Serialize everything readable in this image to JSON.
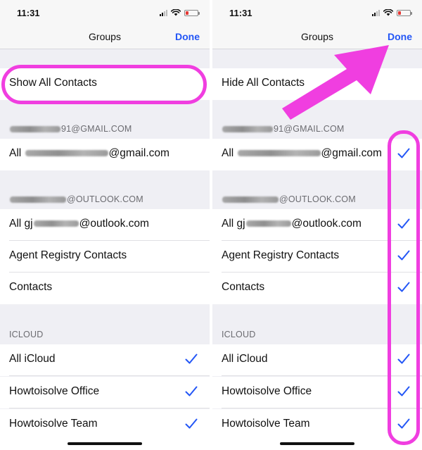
{
  "status_bar": {
    "time": "11:31"
  },
  "colors": {
    "accent": "#2356f6",
    "highlight": "#f03ee0",
    "battery_low": "#e53935"
  },
  "left_screen": {
    "nav_title": "Groups",
    "done_label": "Done",
    "toggle_all_label": "Show All Contacts",
    "gmail": {
      "header_suffix": "91@GMAIL.COM",
      "row_prefix": "All ",
      "row_suffix": "@gmail.com",
      "checked": false
    },
    "outlook": {
      "header_suffix": "@OUTLOOK.COM",
      "row_prefix": "All gj",
      "row_suffix": "@outlook.com",
      "agent_registry_label": "Agent Registry Contacts",
      "contacts_label": "Contacts",
      "checked": false
    },
    "icloud": {
      "header": "ICLOUD",
      "all_label": "All iCloud",
      "office_label": "Howtoisolve Office",
      "team_label": "Howtoisolve Team",
      "checked": true
    }
  },
  "right_screen": {
    "nav_title": "Groups",
    "done_label": "Done",
    "toggle_all_label": "Hide All Contacts",
    "gmail": {
      "header_suffix": "91@GMAIL.COM",
      "row_prefix": "All ",
      "row_suffix": "@gmail.com",
      "checked": true
    },
    "outlook": {
      "header_suffix": "@OUTLOOK.COM",
      "row_prefix": "All gj",
      "row_suffix": "@outlook.com",
      "agent_registry_label": "Agent Registry Contacts",
      "contacts_label": "Contacts",
      "checked": true
    },
    "icloud": {
      "header": "ICLOUD",
      "all_label": "All iCloud",
      "office_label": "Howtoisolve Office",
      "team_label": "Howtoisolve Team",
      "checked": true
    }
  },
  "icons": {
    "checkmark": "checkmark-icon",
    "highlight_arrow": "arrow-annotation-icon",
    "signal": "cellular-signal-icon",
    "wifi": "wifi-icon",
    "battery": "battery-icon"
  }
}
